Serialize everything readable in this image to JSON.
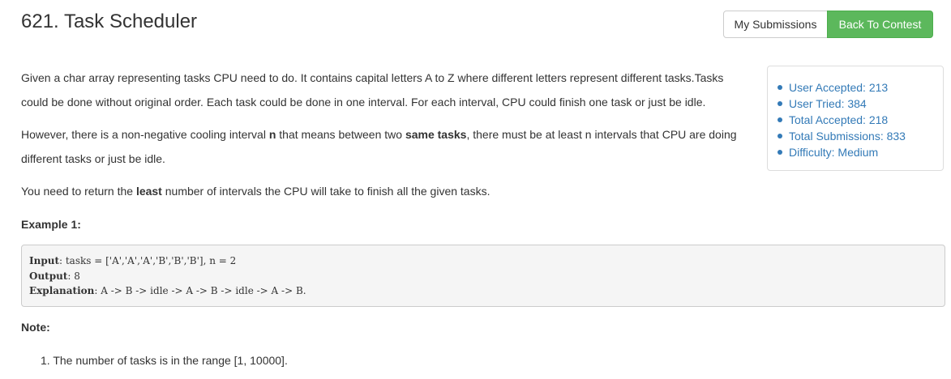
{
  "header": {
    "title": "621. Task Scheduler",
    "my_submissions_label": "My Submissions",
    "back_to_contest_label": "Back To Contest"
  },
  "colors": {
    "success": "#5cb85c",
    "link": "#337ab7",
    "code_bg": "#f5f5f5"
  },
  "description": {
    "p1": "Given a char array representing tasks CPU need to do. It contains capital letters A to Z where different letters represent different tasks.Tasks could be done without original order. Each task could be done in one interval. For each interval, CPU could finish one task or just be idle.",
    "p2_a": "However, there is a non-negative cooling interval ",
    "p2_n": "n",
    "p2_b": " that means between two ",
    "p2_same": "same tasks",
    "p2_c": ", there must be at least n intervals that CPU are doing different tasks or just be idle.",
    "p3_a": "You need to return the ",
    "p3_least": "least",
    "p3_b": " number of intervals the CPU will take to finish all the given tasks."
  },
  "example": {
    "title": "Example 1:",
    "input_label": "Input",
    "input_value": ": tasks = ['A','A','A','B','B','B'], n = 2",
    "output_label": "Output",
    "output_value": ": 8",
    "explanation_label": "Explanation",
    "explanation_value": ": A -> B -> idle -> A -> B -> idle -> A -> B."
  },
  "note": {
    "title": "Note:",
    "items": [
      {
        "number": "1.",
        "text": "The number of tasks is in the range [1, 10000]."
      }
    ]
  },
  "stats": {
    "items": [
      "User Accepted: 213",
      "User Tried: 384",
      "Total Accepted: 218",
      "Total Submissions: 833",
      "Difficulty: Medium"
    ]
  }
}
